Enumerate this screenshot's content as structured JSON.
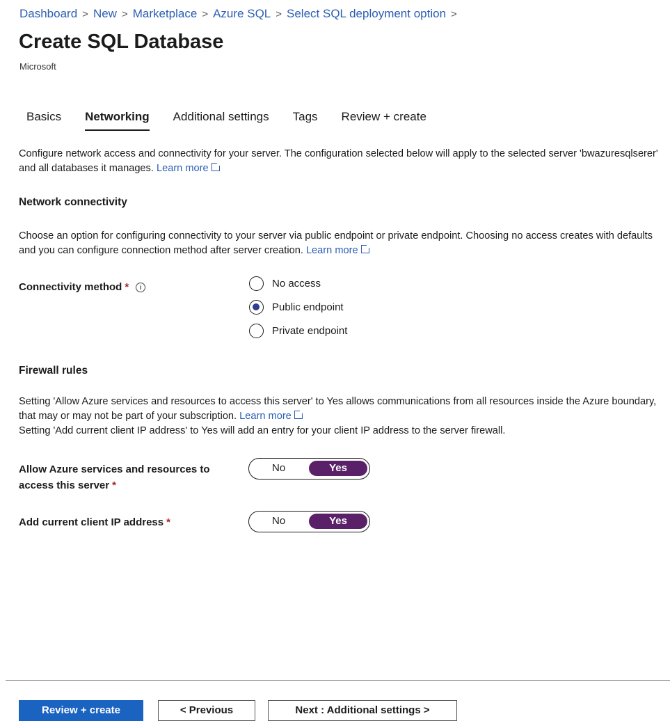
{
  "breadcrumb": [
    "Dashboard",
    "New",
    "Marketplace",
    "Azure SQL",
    "Select SQL deployment option"
  ],
  "breadcrumb_separator": ">",
  "title": "Create SQL Database",
  "subtitle": "Microsoft",
  "tabs": [
    {
      "label": "Basics",
      "active": false
    },
    {
      "label": "Networking",
      "active": true
    },
    {
      "label": "Additional settings",
      "active": false
    },
    {
      "label": "Tags",
      "active": false
    },
    {
      "label": "Review + create",
      "active": false
    }
  ],
  "intro": {
    "text": "Configure network access and connectivity for your server. The configuration selected below will apply to the selected server 'bwazuresqlserer' and all databases it manages.",
    "link": "Learn more"
  },
  "network_connectivity": {
    "heading": "Network connectivity",
    "description": "Choose an option for configuring connectivity to your server via public endpoint or private endpoint. Choosing no access creates with defaults and you can configure connection method after server creation.",
    "link": "Learn more",
    "method_label": "Connectivity method",
    "required_mark": "*",
    "info_icon": "i",
    "options": [
      "No access",
      "Public endpoint",
      "Private endpoint"
    ],
    "selected": "Public endpoint"
  },
  "firewall": {
    "heading": "Firewall rules",
    "line1": "Setting 'Allow Azure services and resources to access this server' to Yes allows communications from all resources inside the Azure boundary, that may or may not be part of your subscription.",
    "link": "Learn more",
    "line2": "Setting 'Add current client IP address' to Yes will add an entry for your client IP address to the server firewall.",
    "allow_azure": {
      "label_line1": "Allow Azure services and resources to",
      "label_line2": "access this server",
      "no": "No",
      "yes": "Yes",
      "value": "Yes"
    },
    "client_ip": {
      "label": "Add current client IP address",
      "no": "No",
      "yes": "Yes",
      "value": "Yes"
    }
  },
  "footer": {
    "review_create": "Review + create",
    "previous": "< Previous",
    "next": "Next : Additional settings >"
  },
  "colors": {
    "link": "#2b5eb3",
    "primary_button": "#1a63c0",
    "toggle_on": "#5a2169",
    "required": "#a4262c"
  }
}
